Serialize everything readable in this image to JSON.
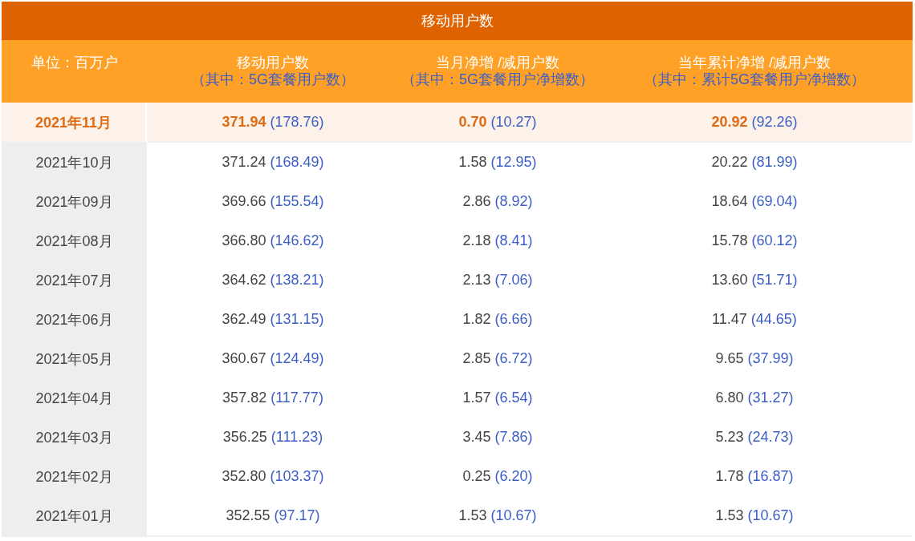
{
  "table": {
    "title": "移动用户数",
    "unit_header": "单位：百万户",
    "columns": [
      {
        "title": "移动用户数",
        "note": "（其中：5G套餐用户数）"
      },
      {
        "title": "当月净增 /减用户数",
        "note": "（其中：5G套餐用户净增数）"
      },
      {
        "title": "当年累计净增 /减用户数",
        "note": "（其中：累计5G套餐用户净增数）"
      }
    ],
    "rows": [
      {
        "month": "2021年11月",
        "highlighted": true,
        "cells": [
          {
            "value": "371.94",
            "sub": "(178.76)"
          },
          {
            "value": "0.70",
            "sub": "(10.27)"
          },
          {
            "value": "20.92",
            "sub": "(92.26)"
          }
        ]
      },
      {
        "month": "2021年10月",
        "highlighted": false,
        "cells": [
          {
            "value": "371.24",
            "sub": "(168.49)"
          },
          {
            "value": "1.58",
            "sub": "(12.95)"
          },
          {
            "value": "20.22",
            "sub": "(81.99)"
          }
        ]
      },
      {
        "month": "2021年09月",
        "highlighted": false,
        "cells": [
          {
            "value": "369.66",
            "sub": "(155.54)"
          },
          {
            "value": "2.86",
            "sub": "(8.92)"
          },
          {
            "value": "18.64",
            "sub": "(69.04)"
          }
        ]
      },
      {
        "month": "2021年08月",
        "highlighted": false,
        "cells": [
          {
            "value": "366.80",
            "sub": "(146.62)"
          },
          {
            "value": "2.18",
            "sub": "(8.41)"
          },
          {
            "value": "15.78",
            "sub": "(60.12)"
          }
        ]
      },
      {
        "month": "2021年07月",
        "highlighted": false,
        "cells": [
          {
            "value": "364.62",
            "sub": "(138.21)"
          },
          {
            "value": "2.13",
            "sub": "(7.06)"
          },
          {
            "value": "13.60",
            "sub": "(51.71)"
          }
        ]
      },
      {
        "month": "2021年06月",
        "highlighted": false,
        "cells": [
          {
            "value": "362.49",
            "sub": "(131.15)"
          },
          {
            "value": "1.82",
            "sub": "(6.66)"
          },
          {
            "value": "11.47",
            "sub": "(44.65)"
          }
        ]
      },
      {
        "month": "2021年05月",
        "highlighted": false,
        "cells": [
          {
            "value": "360.67",
            "sub": "(124.49)"
          },
          {
            "value": "2.85",
            "sub": "(6.72)"
          },
          {
            "value": "9.65",
            "sub": "(37.99)"
          }
        ]
      },
      {
        "month": "2021年04月",
        "highlighted": false,
        "cells": [
          {
            "value": "357.82",
            "sub": "(117.77)"
          },
          {
            "value": "1.57",
            "sub": "(6.54)"
          },
          {
            "value": "6.80",
            "sub": "(31.27)"
          }
        ]
      },
      {
        "month": "2021年03月",
        "highlighted": false,
        "cells": [
          {
            "value": "356.25",
            "sub": "(111.23)"
          },
          {
            "value": "3.45",
            "sub": "(7.86)"
          },
          {
            "value": "5.23",
            "sub": "(24.73)"
          }
        ]
      },
      {
        "month": "2021年02月",
        "highlighted": false,
        "cells": [
          {
            "value": "352.80",
            "sub": "(103.37)"
          },
          {
            "value": "0.25",
            "sub": "(6.20)"
          },
          {
            "value": "1.78",
            "sub": "(16.87)"
          }
        ]
      },
      {
        "month": "2021年01月",
        "highlighted": false,
        "cells": [
          {
            "value": "352.55",
            "sub": "(97.17)"
          },
          {
            "value": "1.53",
            "sub": "(10.67)"
          },
          {
            "value": "1.53",
            "sub": "(10.67)"
          }
        ]
      }
    ]
  }
}
